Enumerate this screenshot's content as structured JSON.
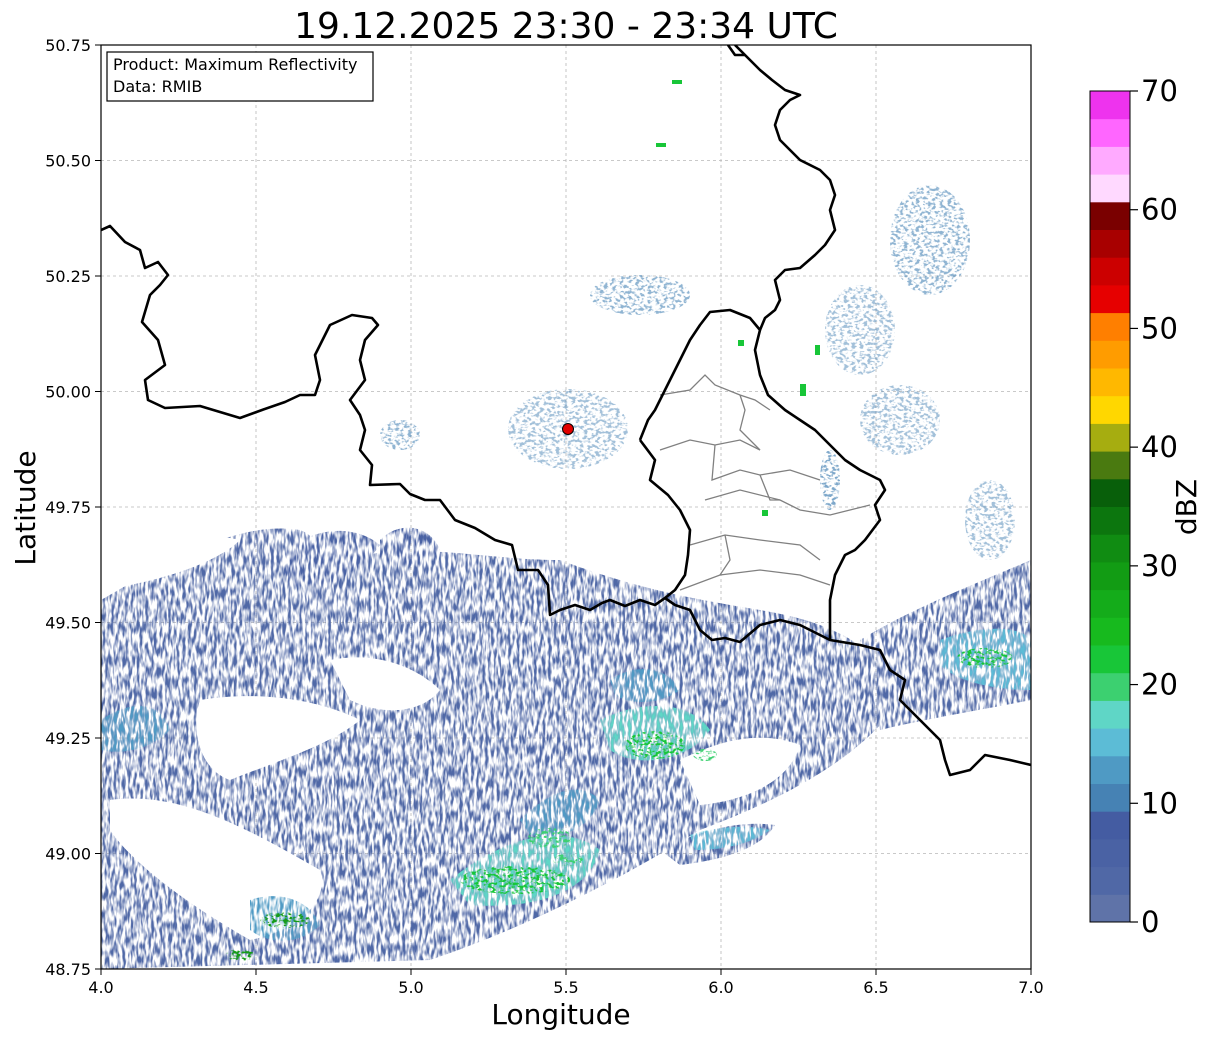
{
  "title": "19.12.2025 23:30 - 23:34 UTC",
  "xlabel": "Longitude",
  "ylabel": "Latitude",
  "info_box": {
    "line1": "Product: Maximum Reflectivity",
    "line2": "Data: RMIB"
  },
  "x_ticks": [
    "4.0",
    "4.5",
    "5.0",
    "5.5",
    "6.0",
    "6.5",
    "7.0"
  ],
  "y_ticks": [
    "50.75",
    "50.50",
    "50.25",
    "50.00",
    "49.75",
    "49.50",
    "49.25",
    "49.00",
    "48.75"
  ],
  "colorbar": {
    "label": "dBZ",
    "ticks": [
      "0",
      "10",
      "20",
      "30",
      "40",
      "50",
      "60",
      "70"
    ],
    "range": [
      0,
      70
    ],
    "step": 2.5,
    "colors": [
      "#5f73a8",
      "#5068a6",
      "#4a62a4",
      "#445ca2",
      "#4682b4",
      "#4f9ac4",
      "#5cbcd6",
      "#5fd6c6",
      "#3cd070",
      "#18c638",
      "#17ba1e",
      "#14ac1a",
      "#129c14",
      "#108c12",
      "#0c760e",
      "#085f0a",
      "#4a7a10",
      "#a6ad10",
      "#ffd700",
      "#ffb800",
      "#ff9c00",
      "#ff7f00",
      "#e60000",
      "#cc0000",
      "#a80000",
      "#7a0000",
      "#ffd9ff",
      "#ffaaff",
      "#ff66ff",
      "#ee33ee"
    ]
  },
  "chart_data": {
    "type": "heatmap",
    "title": "19.12.2025 23:30 - 23:34 UTC",
    "xlabel": "Longitude",
    "ylabel": "Latitude",
    "xlim": [
      4.0,
      7.0
    ],
    "ylim": [
      48.75,
      50.75
    ],
    "grid": true,
    "colorbar_label": "dBZ",
    "value_range": [
      0,
      70
    ],
    "radar_site": {
      "lon": 5.51,
      "lat": 49.91
    },
    "precipitation_cells": [
      {
        "lon": 4.45,
        "lat": 49.25,
        "dbz": 8
      },
      {
        "lon": 4.2,
        "lat": 49.3,
        "dbz": 10
      },
      {
        "lon": 4.6,
        "lat": 48.95,
        "dbz": 12
      },
      {
        "lon": 4.55,
        "lat": 48.85,
        "dbz": 28
      },
      {
        "lon": 4.4,
        "lat": 48.78,
        "dbz": 25
      },
      {
        "lon": 5.35,
        "lat": 48.93,
        "dbz": 24
      },
      {
        "lon": 5.45,
        "lat": 49.05,
        "dbz": 20
      },
      {
        "lon": 5.75,
        "lat": 49.25,
        "dbz": 22
      },
      {
        "lon": 5.65,
        "lat": 49.35,
        "dbz": 15
      },
      {
        "lon": 6.85,
        "lat": 49.4,
        "dbz": 22
      },
      {
        "lon": 4.8,
        "lat": 49.7,
        "dbz": 6
      },
      {
        "lon": 5.0,
        "lat": 49.65,
        "dbz": 6
      },
      {
        "lon": 5.5,
        "lat": 49.55,
        "dbz": 5
      },
      {
        "lon": 6.1,
        "lat": 49.05,
        "dbz": 10
      }
    ]
  }
}
